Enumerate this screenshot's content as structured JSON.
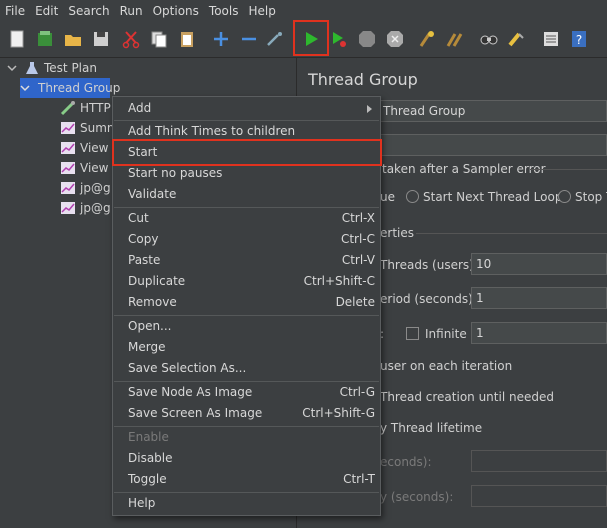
{
  "menubar": [
    "File",
    "Edit",
    "Search",
    "Run",
    "Options",
    "Tools",
    "Help"
  ],
  "tree": {
    "test_plan": "Test Plan",
    "thread_group": "Thread Group",
    "children": [
      "HTTP",
      "Summ",
      "View",
      "View",
      "jp@g",
      "jp@g"
    ]
  },
  "panel": {
    "title": "Thread Group",
    "name_value": "Thread Group",
    "comments_value": "",
    "error_action_label": "taken after a Sampler error",
    "radio_continue": "ue",
    "radio_next_loop": "Start Next Thread Loop",
    "radio_stop": "Stop T",
    "properties_label": "erties",
    "threads_label": "Threads (users):",
    "threads_value": "10",
    "rampup_label": "eriod (seconds):",
    "rampup_value": "1",
    "loop_label": ":",
    "infinite_label": "Infinite",
    "loop_value": "1",
    "same_user_label": "user on each iteration",
    "delay_label": "Thread creation until needed",
    "lifetime_label": "y Thread lifetime",
    "duration_label": "econds):",
    "startup_delay_label": "y (seconds):"
  },
  "context_menu": {
    "add": "Add",
    "think_times": "Add Think Times to children",
    "start": "Start",
    "start_no_pauses": "Start no pauses",
    "validate": "Validate",
    "cut": "Cut",
    "cut_sc": "Ctrl-X",
    "copy": "Copy",
    "copy_sc": "Ctrl-C",
    "paste": "Paste",
    "paste_sc": "Ctrl-V",
    "duplicate": "Duplicate",
    "duplicate_sc": "Ctrl+Shift-C",
    "remove": "Remove",
    "remove_sc": "Delete",
    "open": "Open...",
    "merge": "Merge",
    "save_selection": "Save Selection As...",
    "save_node_image": "Save Node As Image",
    "save_node_image_sc": "Ctrl-G",
    "save_screen_image": "Save Screen As Image",
    "save_screen_image_sc": "Ctrl+Shift-G",
    "enable": "Enable",
    "disable": "Disable",
    "toggle": "Toggle",
    "toggle_sc": "Ctrl-T",
    "help": "Help"
  },
  "colors": {
    "highlight": "#e0321e",
    "selection": "#2f65ca",
    "start_green": "#2eb82e"
  }
}
